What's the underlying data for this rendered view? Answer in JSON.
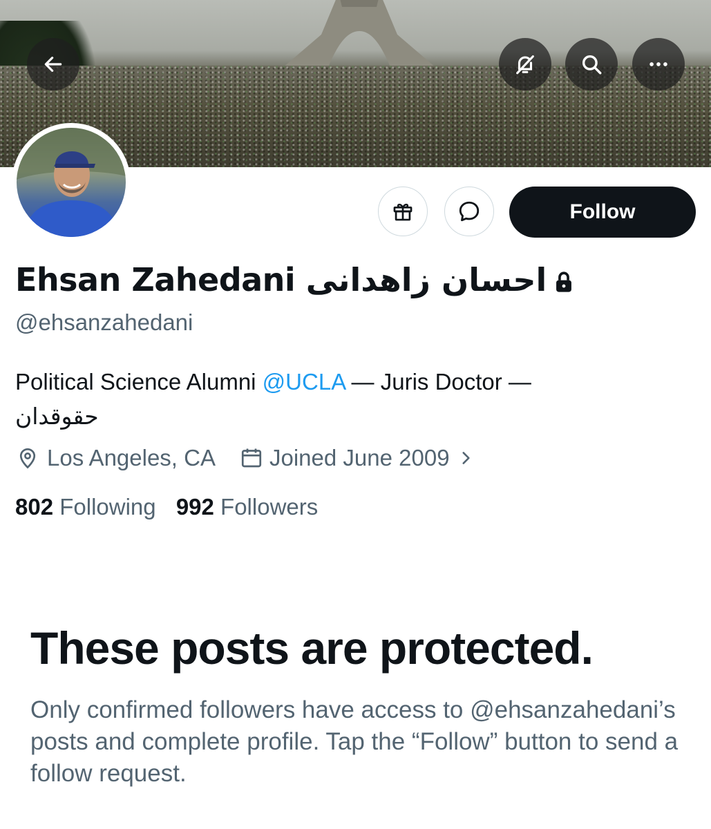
{
  "header": {
    "back_icon": "arrow-left-icon",
    "notifications_icon": "bell-slash-icon",
    "search_icon": "search-icon",
    "more_icon": "more-dots-icon"
  },
  "actions": {
    "gift_icon": "gift-icon",
    "message_icon": "message-bubble-icon",
    "follow_label": "Follow"
  },
  "profile": {
    "name": "Ehsan Zahedani احسان زاهدانی",
    "lock_icon": "lock-icon",
    "handle": "@ehsanzahedani",
    "bio_prefix": "Political Science Alumni ",
    "bio_link": "@UCLA",
    "bio_suffix": " — Juris Doctor —",
    "bio_persian": "حقوقدان",
    "location": "Los Angeles, CA",
    "joined": "Joined June 2009",
    "following_count": "802",
    "following_label": "Following",
    "followers_count": "992",
    "followers_label": "Followers"
  },
  "protected": {
    "title": "These posts are protected.",
    "message": "Only confirmed followers have access to @ehsanzahedani’s posts and complete profile. Tap the “Follow” button to send a follow request."
  },
  "colors": {
    "text": "#0f1419",
    "muted": "#536471",
    "link": "#1d9bf0",
    "button": "#0f1419"
  }
}
